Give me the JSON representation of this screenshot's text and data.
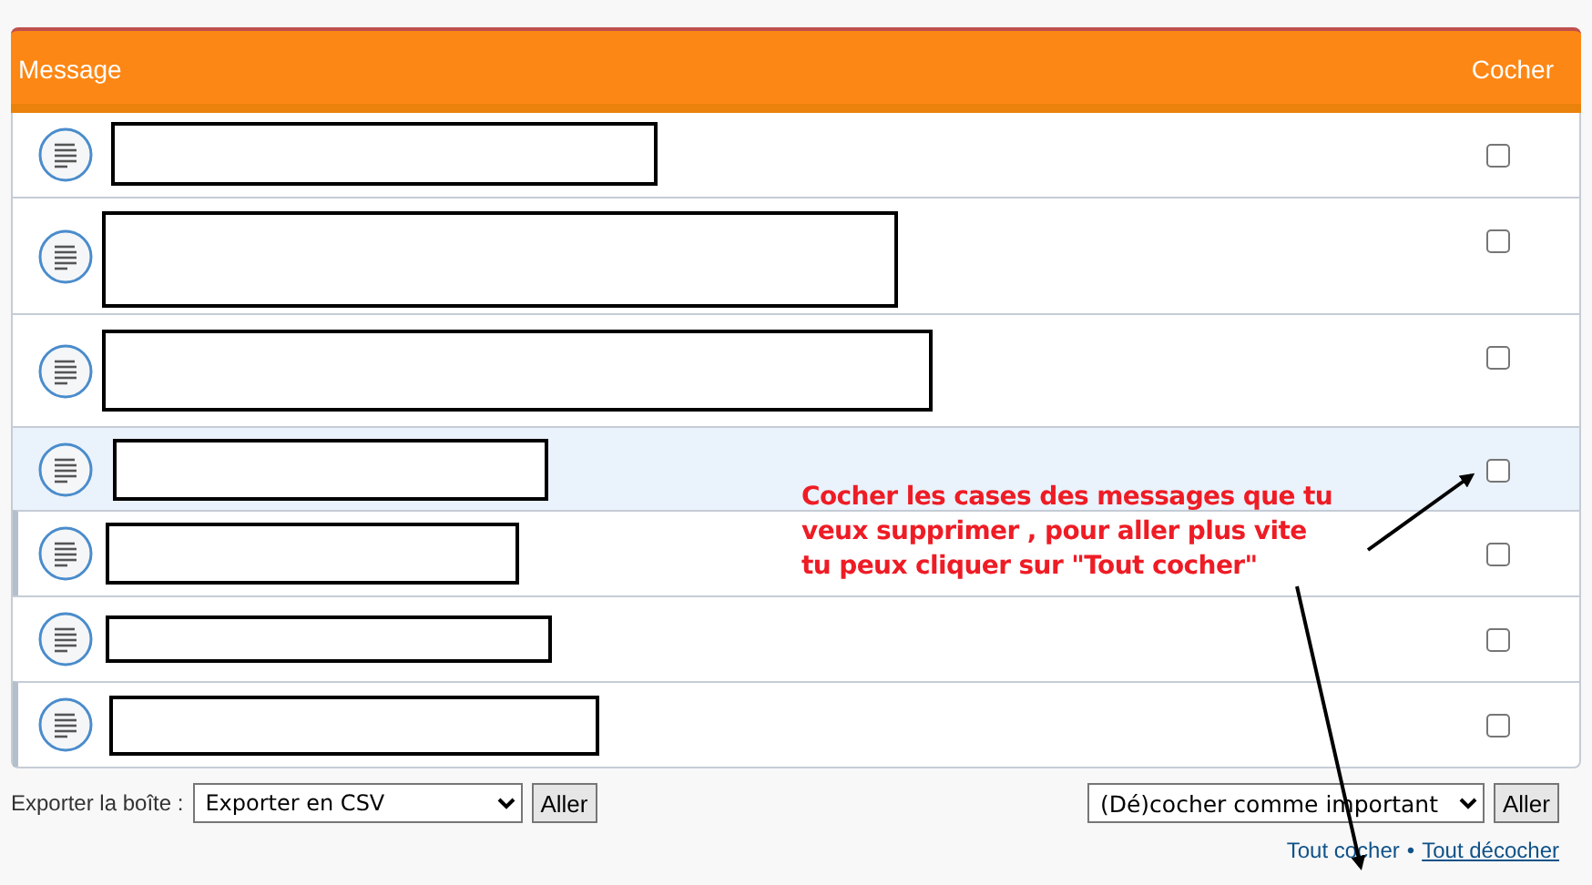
{
  "table": {
    "columns": [
      {
        "label": "Message"
      },
      {
        "label": "Cocher"
      }
    ],
    "rows": [
      {
        "checked": false,
        "highlighted": false,
        "marked": false
      },
      {
        "checked": false,
        "highlighted": false,
        "marked": false
      },
      {
        "checked": false,
        "highlighted": false,
        "marked": false
      },
      {
        "checked": false,
        "highlighted": true,
        "marked": false
      },
      {
        "checked": false,
        "highlighted": false,
        "marked": true
      },
      {
        "checked": false,
        "highlighted": false,
        "marked": false
      },
      {
        "checked": false,
        "highlighted": false,
        "marked": true
      }
    ]
  },
  "export": {
    "label": "Exporter la boîte :",
    "select": "Exporter en CSV",
    "button": "Aller"
  },
  "mark": {
    "select": "(Dé)cocher comme important",
    "button": "Aller"
  },
  "links": [
    {
      "label": "Tout cocher",
      "hovered": false
    },
    {
      "label": "Tout décocher",
      "hovered": true
    }
  ],
  "separator": "•",
  "annotation": {
    "text": "Cocher les cases des messages que tu\nveux supprimer , pour aller plus vite\ntu peux cliquer sur \"Tout cocher\""
  }
}
